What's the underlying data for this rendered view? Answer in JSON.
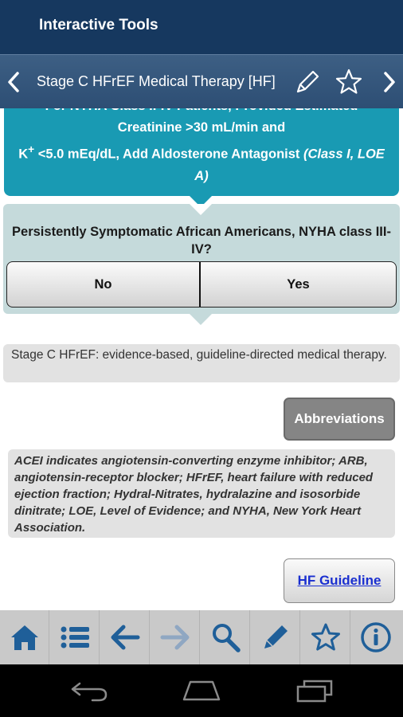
{
  "app_bar": {
    "title": "Interactive Tools"
  },
  "sub_bar": {
    "title": "Stage C HFrEF Medical Therapy [HF]"
  },
  "recommendation": {
    "line1": "For NYHA Class II-IV Patients, Provided Estimated",
    "line2": "Creatinine >30 mL/min and",
    "line3_k": "K",
    "line3_sup": "+",
    "line3_rest": " <5.0 mEq/dL, Add Aldosterone Antagonist ",
    "line3_class": "(Class I, LOE A)"
  },
  "question": {
    "text": "Persistently Symptomatic African Americans, NYHA class III-IV?",
    "no_label": "No",
    "yes_label": "Yes"
  },
  "result": {
    "text": "Stage C HFrEF: evidence-based, guideline-directed medical therapy."
  },
  "abbreviations_button": "Abbreviations",
  "abbreviations_note": "ACEI indicates angiotensin-converting enzyme inhibitor; ARB, angiotensin-receptor blocker; HFrEF, heart failure with reduced ejection fraction; Hydral-Nitrates, hydralazine and isosorbide dinitrate; LOE, Level of Evidence; and NYHA, New York Heart Association.",
  "guideline_button": "HF Guideline",
  "toolbar": [
    "home-icon",
    "list-icon",
    "back-arrow-icon",
    "forward-arrow-icon",
    "search-icon",
    "pencil-icon",
    "star-icon",
    "info-icon"
  ],
  "colors": {
    "header": "#16385f",
    "teal": "#199ab3",
    "question_bg": "#c5dadb",
    "icon_blue": "#1f5f99"
  }
}
